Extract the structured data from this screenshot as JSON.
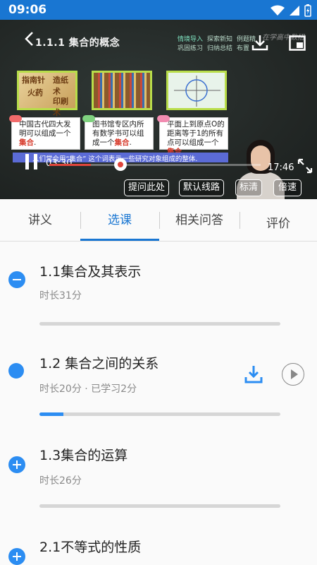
{
  "status_bar": {
    "time": "09:06",
    "icons": [
      "wifi-icon",
      "signal-icon",
      "battery-icon"
    ]
  },
  "video": {
    "title": "1.1.1 集合的概念",
    "menu_tags": [
      "情境导入",
      "探索新知",
      "例题精",
      "巩固练习",
      "归纳总结",
      "布置"
    ],
    "watermark": "在学高中数招",
    "images": [
      {
        "labels": [
          "指南针",
          "造纸术",
          "火药",
          "印刷术"
        ]
      },
      {
        "labels": []
      },
      {
        "labels": []
      }
    ],
    "cards": [
      {
        "text": "中国古代四大发明可以组成一个",
        "emphasis": "集合",
        "end": "."
      },
      {
        "text": "图书馆专区内所有数学书可以组成一个",
        "emphasis": "集合",
        "end": "."
      },
      {
        "text": "平面上到原点O的距离等于1的所有点可以组成一个",
        "emphasis": "集合",
        "end": "."
      }
    ],
    "subtitle": "人们常会用“集合” 这个词表示一些研究对象组成的整体.",
    "current_time": "03:30",
    "total_time": "17:46",
    "played_fraction": 0.197,
    "buttons": [
      "提问此处",
      "默认线路",
      "标清",
      "倍速"
    ],
    "accent_color": "#e0463c"
  },
  "tabs": {
    "items": [
      "讲义",
      "选课",
      "相关问答",
      "评价"
    ],
    "active_index": 1,
    "active_color": "#1976d2"
  },
  "lessons": [
    {
      "title": "1.1集合及其表示",
      "meta": "时长31分",
      "state": "expanded",
      "progress": 0
    },
    {
      "title": "1.2 集合之间的关系",
      "meta": "时长20分 · 已学习2分",
      "state": "current",
      "progress": 0.1
    },
    {
      "title": "1.3集合的运算",
      "meta": "时长26分",
      "state": "collapsed",
      "progress": 0
    },
    {
      "title": "2.1不等式的性质",
      "meta": "",
      "state": "collapsed",
      "progress": 0
    }
  ]
}
